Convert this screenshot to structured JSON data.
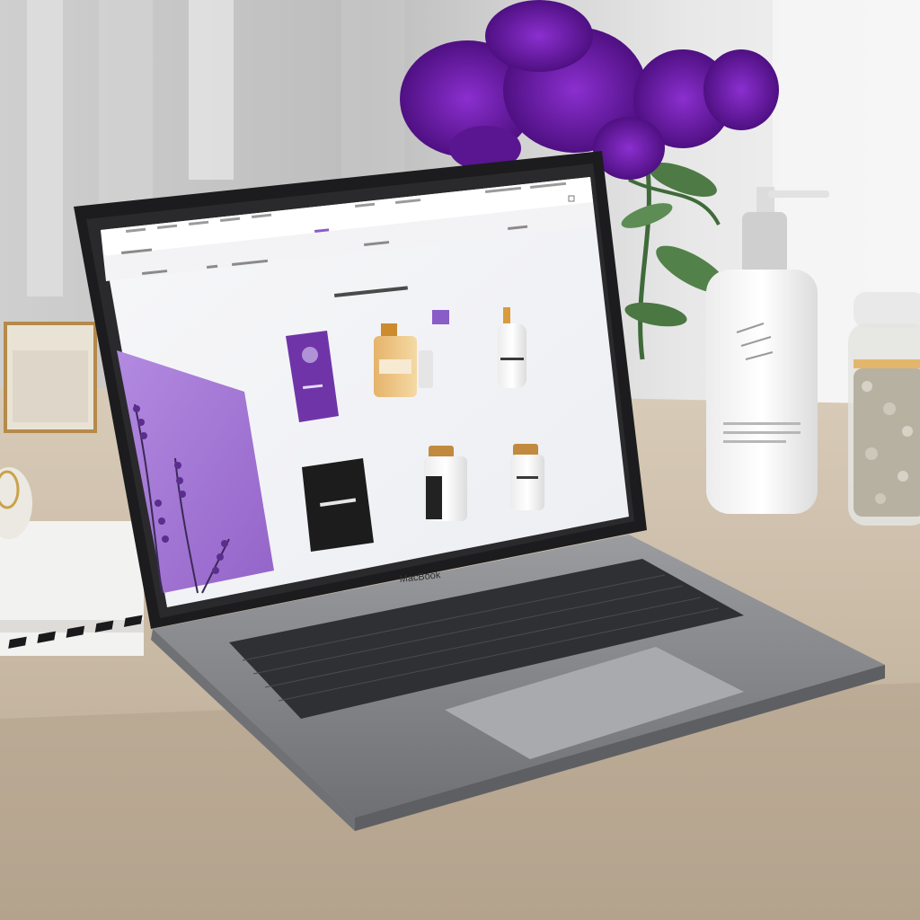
{
  "laptop": {
    "brand": "MacBook"
  },
  "website": {
    "nav": {
      "top_items": [
        "",
        "",
        "",
        "",
        "",
        "",
        ""
      ],
      "utility_items": [
        "",
        "",
        ""
      ],
      "left_items": [
        "",
        "",
        ""
      ],
      "breadcrumb": [
        "",
        "",
        ""
      ]
    },
    "headline": "",
    "products": [
      {
        "name": "",
        "type": "box"
      },
      {
        "name": "",
        "type": "serum-amber"
      },
      {
        "name": "",
        "type": "dropper-bottle"
      },
      {
        "name": "",
        "type": "black-box"
      },
      {
        "name": "",
        "type": "jar-dark"
      },
      {
        "name": "",
        "type": "jar-light"
      }
    ]
  },
  "colors": {
    "accent_purple": "#8a5cc7",
    "panel_purple": "#a87ed6",
    "flowers": "#6a1fa0",
    "desk": "#cdbca7",
    "laptop_silver": "#8e8f93"
  },
  "icons": [
    "flower-bouquet-icon",
    "pump-bottle-icon",
    "glass-jar-icon",
    "trackpad-icon",
    "keyboard-icon"
  ]
}
